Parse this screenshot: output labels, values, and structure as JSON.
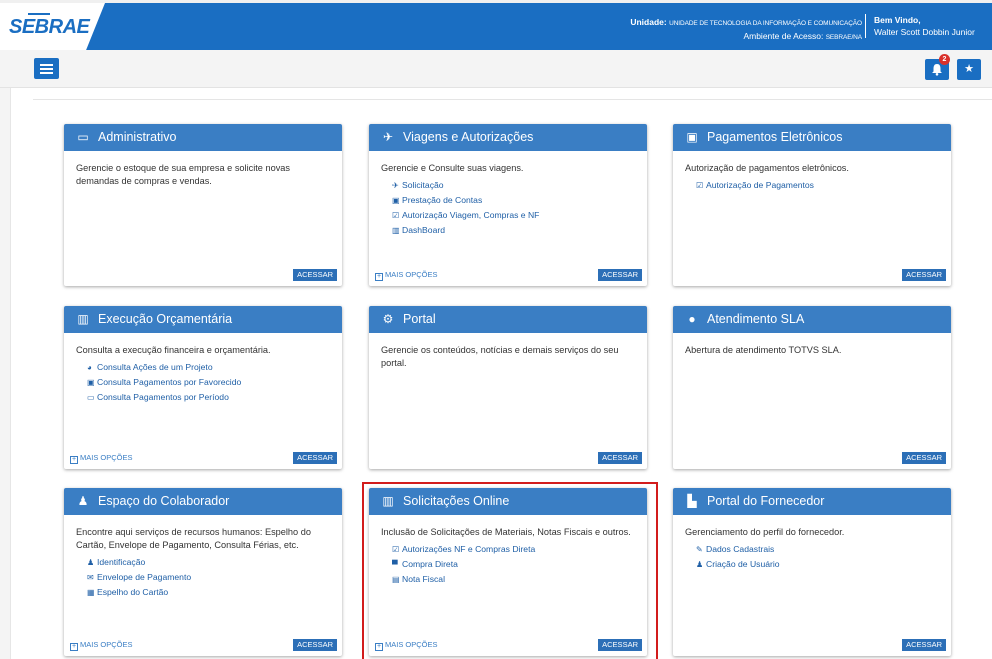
{
  "header": {
    "logo_text": "SEBRAE",
    "unit_label": "Unidade:",
    "unit_value": "UNIDADE DE TECNOLOGIA DA INFORMAÇÃO E COMUNICAÇÃO",
    "env_label": "Ambiente de Acesso:",
    "env_value": "SEBRAE/NA",
    "welcome": "Bem Vindo,",
    "user": "Walter Scott Dobbin Junior"
  },
  "toolbar": {
    "notification_count": "2",
    "star_glyph": "★"
  },
  "colors": {
    "brand": "#1a6ec2",
    "card_header": "#3a7ec4",
    "highlight": "#d21c1c"
  },
  "cards": [
    {
      "title": "Administrativo",
      "icon": "calendar-icon",
      "glyph": "▭",
      "desc": "Gerencie o estoque de sua empresa e solicite novas demandas de compras e vendas.",
      "links": [],
      "more": "",
      "access": "ACESSAR"
    },
    {
      "title": "Viagens e Autorizações",
      "icon": "plane-icon",
      "glyph": "✈",
      "desc": "Gerencie e Consulte suas viagens.",
      "links": [
        {
          "icon": "plane-icon",
          "glyph": "✈",
          "label": "Solicitação"
        },
        {
          "icon": "money-icon",
          "glyph": "▣",
          "label": "Prestação de Contas"
        },
        {
          "icon": "check-square-icon",
          "glyph": "☑",
          "label": "Autorização Viagem, Compras e NF"
        },
        {
          "icon": "bar-chart-icon",
          "glyph": "▥",
          "label": "DashBoard"
        }
      ],
      "more": "MAIS OPÇÕES",
      "access": "ACESSAR"
    },
    {
      "title": "Pagamentos Eletrônicos",
      "icon": "money-icon",
      "glyph": "▣",
      "desc": "Autorização de pagamentos eletrônicos.",
      "links": [
        {
          "icon": "check-square-icon",
          "glyph": "☑",
          "label": "Autorização de Pagamentos"
        }
      ],
      "more": "",
      "access": "ACESSAR"
    },
    {
      "title": "Execução Orçamentária",
      "icon": "bar-chart-icon",
      "glyph": "▥",
      "desc": "Consulta a execução financeira e orçamentária.",
      "links": [
        {
          "icon": "pie-chart-icon",
          "glyph": "◕",
          "label": "Consulta Ações de um Projeto"
        },
        {
          "icon": "money-icon",
          "glyph": "▣",
          "label": "Consulta Pagamentos por Favorecido"
        },
        {
          "icon": "calendar-icon",
          "glyph": "▭",
          "label": "Consulta Pagamentos por Período"
        }
      ],
      "more": "MAIS OPÇÕES",
      "access": "ACESSAR"
    },
    {
      "title": "Portal",
      "icon": "gears-icon",
      "glyph": "⚙",
      "desc": "Gerencie os conteúdos, notícias e demais serviços do seu portal.",
      "links": [],
      "more": "",
      "access": "ACESSAR"
    },
    {
      "title": "Atendimento SLA",
      "icon": "comments-icon",
      "glyph": "●",
      "desc": "Abertura de atendimento TOTVS SLA.",
      "links": [],
      "more": "",
      "access": "ACESSAR"
    },
    {
      "title": "Espaço do Colaborador",
      "icon": "users-icon",
      "glyph": "♟",
      "desc": "Encontre aqui serviços de recursos humanos: Espelho do Cartão, Envelope de Pagamento, Consulta Férias, etc.",
      "links": [
        {
          "icon": "user-icon",
          "glyph": "♟",
          "label": "Identificação"
        },
        {
          "icon": "envelope-icon",
          "glyph": "✉",
          "label": "Envelope de Pagamento"
        },
        {
          "icon": "calendar-icon",
          "glyph": "▦",
          "label": "Espelho do Cartão"
        }
      ],
      "more": "MAIS OPÇÕES",
      "access": "ACESSAR"
    },
    {
      "title": "Solicitações Online",
      "icon": "bar-chart-icon",
      "glyph": "▥",
      "desc": "Inclusão de Solicitações de Materiais, Notas Fiscais e outros.",
      "links": [
        {
          "icon": "check-square-icon",
          "glyph": "☑",
          "label": "Autorizações NF e Compras Direta"
        },
        {
          "icon": "cart-icon",
          "glyph": "▀",
          "label": "Compra Direta"
        },
        {
          "icon": "file-icon",
          "glyph": "▤",
          "label": "Nota Fiscal"
        }
      ],
      "more": "MAIS OPÇÕES",
      "access": "ACESSAR"
    },
    {
      "title": "Portal do Fornecedor",
      "icon": "industry-icon",
      "glyph": "▙",
      "desc": "Gerenciamento do perfil do fornecedor.",
      "links": [
        {
          "icon": "edit-icon",
          "glyph": "✎",
          "label": "Dados Cadastrais"
        },
        {
          "icon": "user-icon",
          "glyph": "♟",
          "label": "Criação de Usuário"
        }
      ],
      "more": "",
      "access": "ACESSAR"
    }
  ]
}
